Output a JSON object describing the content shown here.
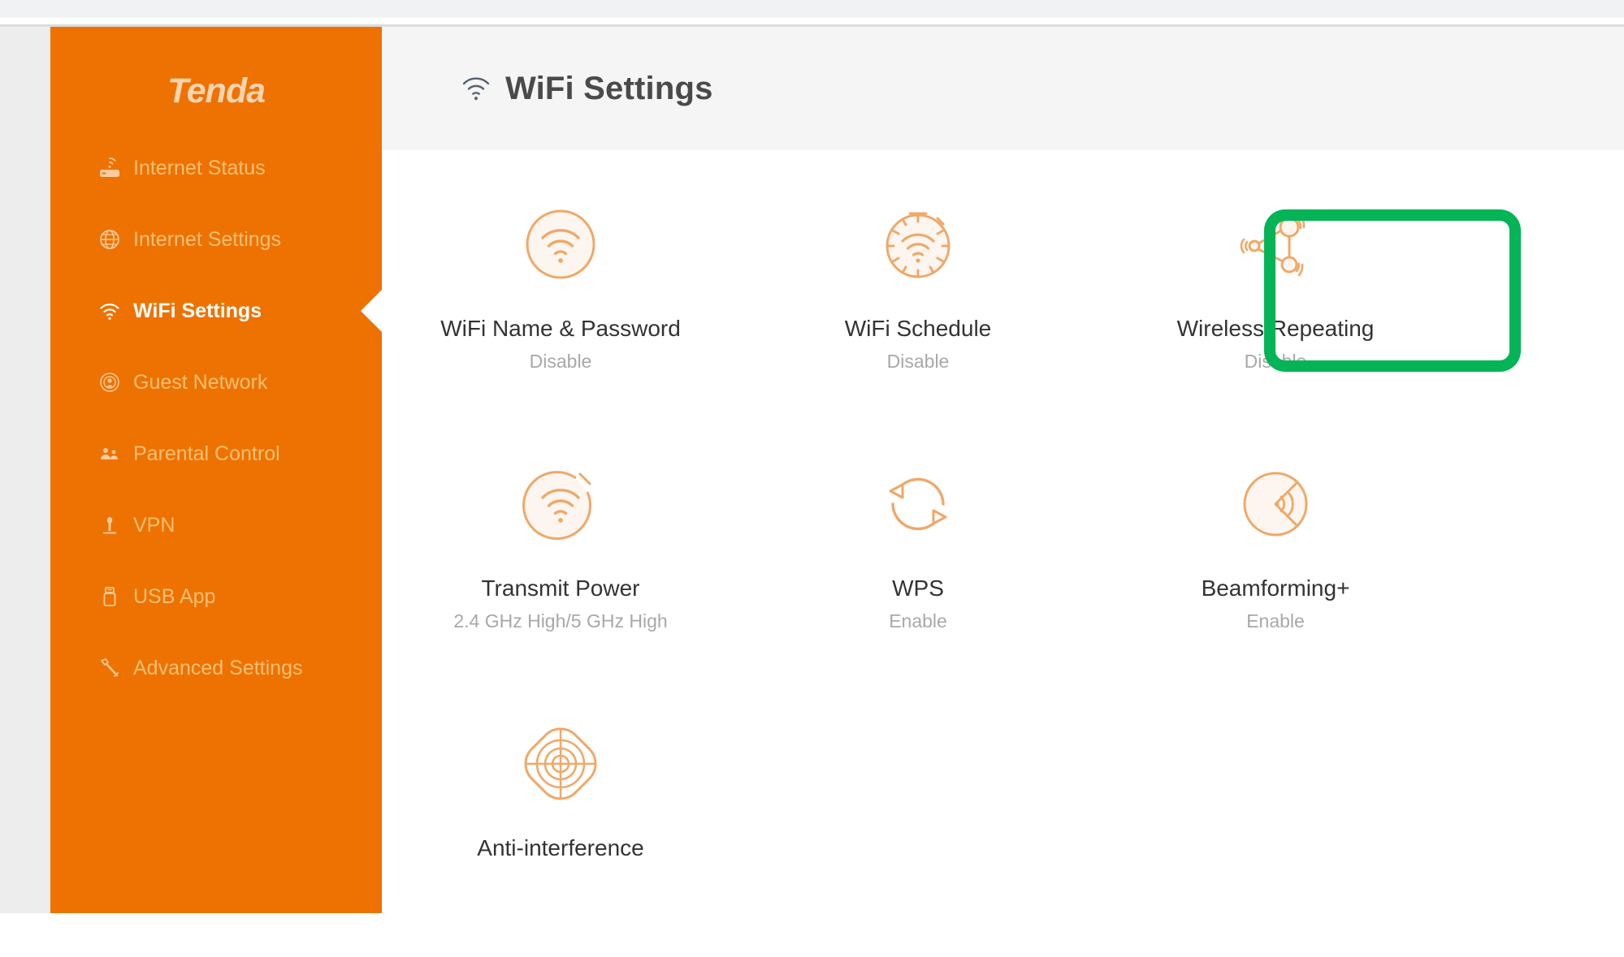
{
  "brand": {
    "name": "Tenda",
    "logo_color": "#fbd4b0",
    "sidebar_color": "#ee7202"
  },
  "header": {
    "title": "WiFi Settings",
    "icon": "wifi-icon"
  },
  "sidebar": {
    "items": [
      {
        "label": "Internet Status",
        "icon": "router-icon",
        "active": false
      },
      {
        "label": "Internet Settings",
        "icon": "globe-icon",
        "active": false
      },
      {
        "label": "WiFi Settings",
        "icon": "wifi-icon",
        "active": true
      },
      {
        "label": "Guest Network",
        "icon": "guest-network-icon",
        "active": false
      },
      {
        "label": "Parental Control",
        "icon": "parental-icon",
        "active": false
      },
      {
        "label": "VPN",
        "icon": "vpn-lock-icon",
        "active": false
      },
      {
        "label": "USB App",
        "icon": "usb-icon",
        "active": false
      },
      {
        "label": "Advanced Settings",
        "icon": "wrench-icon",
        "active": false
      }
    ]
  },
  "main": {
    "cards": [
      {
        "title": "WiFi Name & Password",
        "status": "Disable",
        "icon": "wifi-circle-icon",
        "highlighted": false
      },
      {
        "title": "WiFi Schedule",
        "status": "Disable",
        "icon": "wifi-timer-icon",
        "highlighted": false
      },
      {
        "title": "Wireless Repeating",
        "status": "Disable",
        "icon": "wireless-repeating-icon",
        "highlighted": true
      },
      {
        "title": "Transmit Power",
        "status": "2.4 GHz High/5 GHz High",
        "icon": "transmit-power-icon",
        "highlighted": false
      },
      {
        "title": "WPS",
        "status": "Enable",
        "icon": "wps-refresh-icon",
        "highlighted": false
      },
      {
        "title": "Beamforming+",
        "status": "Enable",
        "icon": "beamforming-icon",
        "highlighted": false
      },
      {
        "title": "Anti-interference",
        "status": "",
        "icon": "anti-interference-icon",
        "highlighted": false
      }
    ]
  },
  "annotation": {
    "highlight_color": "#04b457",
    "target": "Wireless Repeating"
  }
}
